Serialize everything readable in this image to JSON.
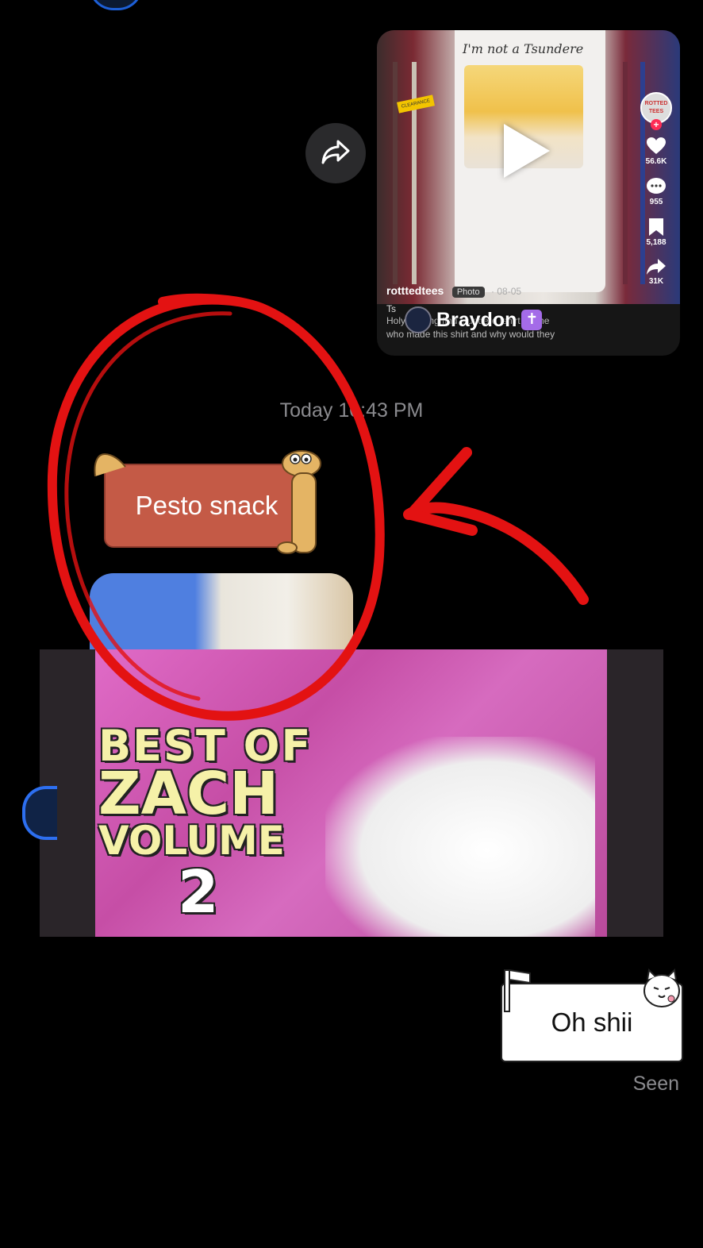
{
  "share": {
    "icon": "share-arrow-icon"
  },
  "tiktok": {
    "shirt_text": "I'm not a Tsundere",
    "clearance": "CLEARANCE",
    "account_badge": "ROTTED TEES",
    "likes": "56.6K",
    "comments": "955",
    "saves": "5,188",
    "shares": "31K",
    "username": "rotttedtees",
    "type_badge": "Photo",
    "date": "· 08-05",
    "title_partial": "Ts",
    "desc_line1": "Holy thrifting find tsundere tshirt meme",
    "desc_line2": "who made this shirt and why would they"
  },
  "overlay": {
    "name": "Braydon",
    "emoji": "✝"
  },
  "chat": {
    "timestamp": "Today 10:43 PM",
    "pesto": "Pesto snack",
    "ohshii": "Oh shii",
    "seen": "Seen"
  },
  "video": {
    "line1": "BEST OF",
    "line2": "ZACH",
    "line3": "VOLUME",
    "line4": "2"
  },
  "colors": {
    "background": "#000000",
    "pesto_bubble": "#c45a46",
    "annotation_red": "#e31212",
    "muted_text": "#8a8a8e"
  }
}
